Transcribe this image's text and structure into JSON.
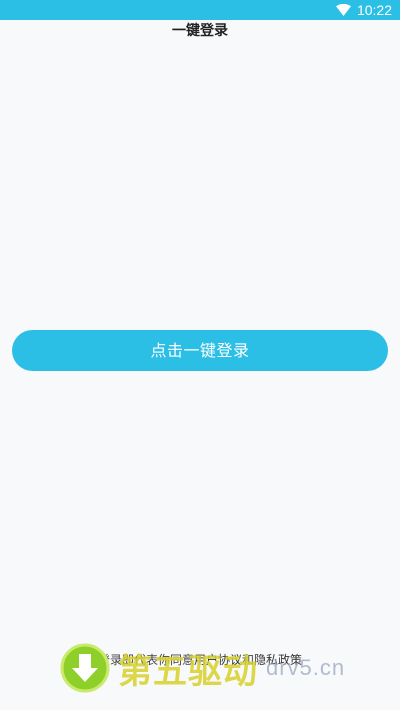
{
  "status_bar": {
    "time": "10:22",
    "wifi_icon": "wifi-icon",
    "bg_color": "#2bbfe6"
  },
  "header": {
    "title": "一键登录"
  },
  "main": {
    "login_button_label": "点击一键登录",
    "accent_color": "#2bbfe6"
  },
  "footer": {
    "agreement_prefix": "登录即代表你同意",
    "user_agreement": "用户协议",
    "and": "和",
    "privacy_policy": "隐私政策"
  },
  "watermark": {
    "text": "第五驱动",
    "domain": "drv5.cn"
  }
}
